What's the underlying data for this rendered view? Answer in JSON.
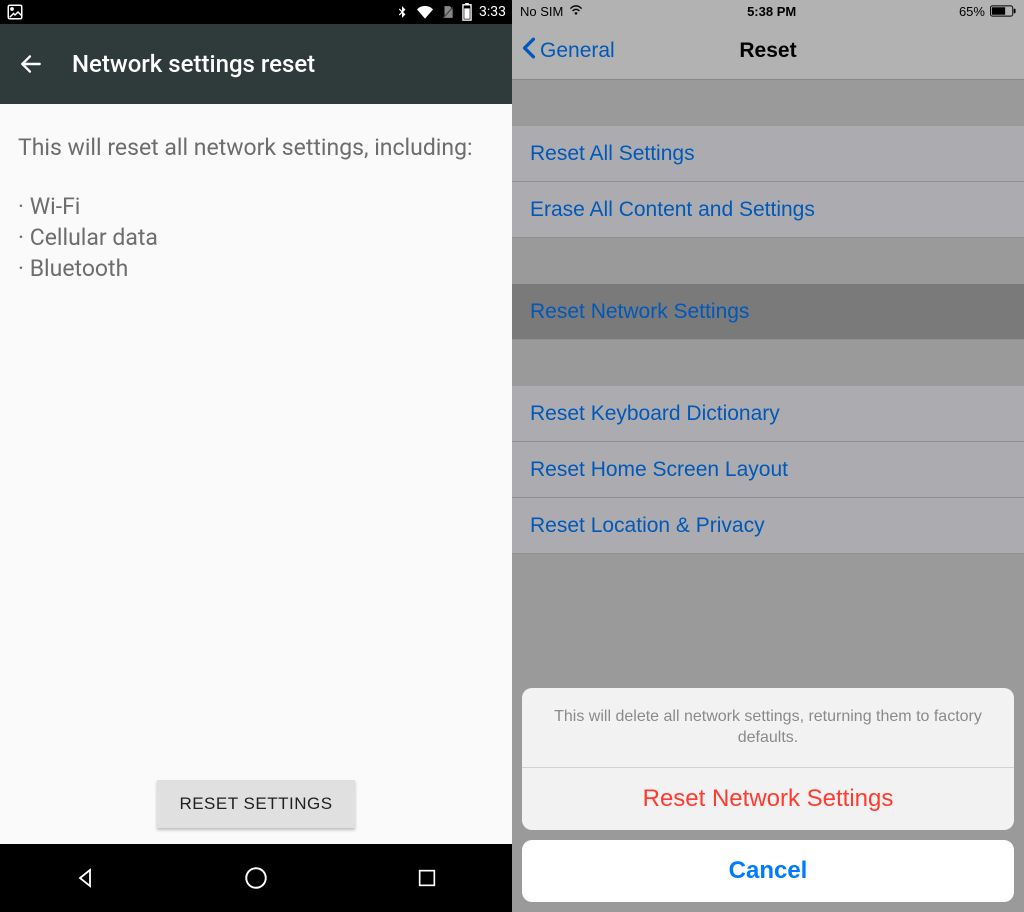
{
  "android": {
    "status": {
      "time": "3:33"
    },
    "appbar": {
      "title": "Network settings reset"
    },
    "body": {
      "lead": "This will reset all network settings, including:",
      "bullets": [
        "Wi-Fi",
        "Cellular data",
        "Bluetooth"
      ]
    },
    "reset_button": "RESET SETTINGS"
  },
  "ios": {
    "status": {
      "carrier": "No SIM",
      "time": "5:38 PM",
      "battery_pct": "65%"
    },
    "navbar": {
      "back": "General",
      "title": "Reset"
    },
    "rows": {
      "reset_all": "Reset All Settings",
      "erase_all": "Erase All Content and Settings",
      "reset_network": "Reset Network Settings",
      "reset_keyboard": "Reset Keyboard Dictionary",
      "reset_home": "Reset Home Screen Layout",
      "reset_location": "Reset Location & Privacy"
    },
    "sheet": {
      "message": "This will delete all network settings, returning them to factory defaults.",
      "destructive": "Reset Network Settings",
      "cancel": "Cancel"
    }
  }
}
